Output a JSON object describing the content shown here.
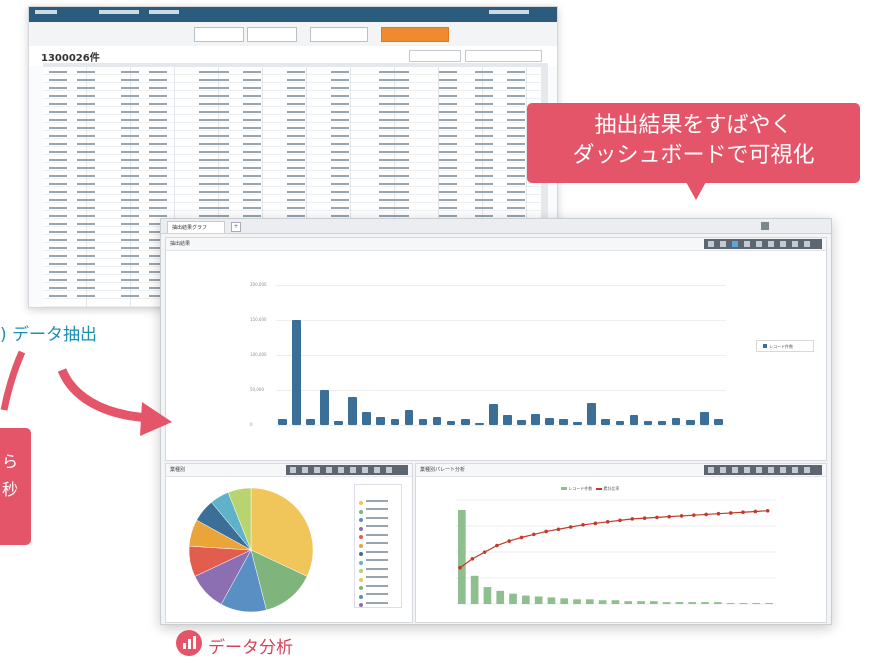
{
  "background_sheet": {
    "record_count": "1300026件"
  },
  "dashboard": {
    "tab_label": "抽出結果グラフ",
    "main_panel_title": "抽出結果",
    "legend_main": "レコード件数",
    "yticks": [
      "200,000",
      "150,000",
      "100,000",
      "50,000",
      "0"
    ],
    "bar_values": [
      8,
      150,
      9,
      50,
      6,
      40,
      18,
      12,
      9,
      22,
      8,
      12,
      6,
      8,
      3,
      30,
      14,
      7,
      16,
      10,
      9,
      5,
      32,
      8,
      6,
      14,
      6,
      6,
      10,
      7,
      18,
      9
    ],
    "pie_panel_title": "業種別",
    "pie_slices": [
      32,
      14,
      12,
      10,
      8,
      7,
      6,
      5,
      6
    ],
    "pie_colors": [
      "#f0c55a",
      "#7fb47d",
      "#5a8fc4",
      "#8c6fb3",
      "#e15d4e",
      "#e9a43a",
      "#3b6f98",
      "#5fb3c9",
      "#b9d36f"
    ],
    "pareto_panel_title": "業種別パレート分析",
    "pareto_legend": [
      "レコード件数",
      "累計比率"
    ],
    "pareto_bars": [
      100,
      30,
      18,
      14,
      11,
      9,
      8,
      7,
      6,
      5,
      5,
      4,
      4,
      3,
      3,
      3,
      2,
      2,
      2,
      2,
      2,
      1,
      1,
      1,
      1
    ],
    "pareto_line": [
      22,
      34,
      43,
      52,
      58,
      63,
      67,
      71,
      74,
      77,
      80,
      82,
      84,
      86,
      88,
      89,
      90,
      91,
      92,
      93,
      94,
      95,
      96,
      97,
      98,
      99
    ]
  },
  "callout": {
    "line1": "抽出結果をすばやく",
    "line2": "ダッシュボードで可視化"
  },
  "left_callout": {
    "line1": "ら",
    "line2": "秒"
  },
  "labels": {
    "extract": ") データ抽出",
    "analysis": "データ分析"
  }
}
